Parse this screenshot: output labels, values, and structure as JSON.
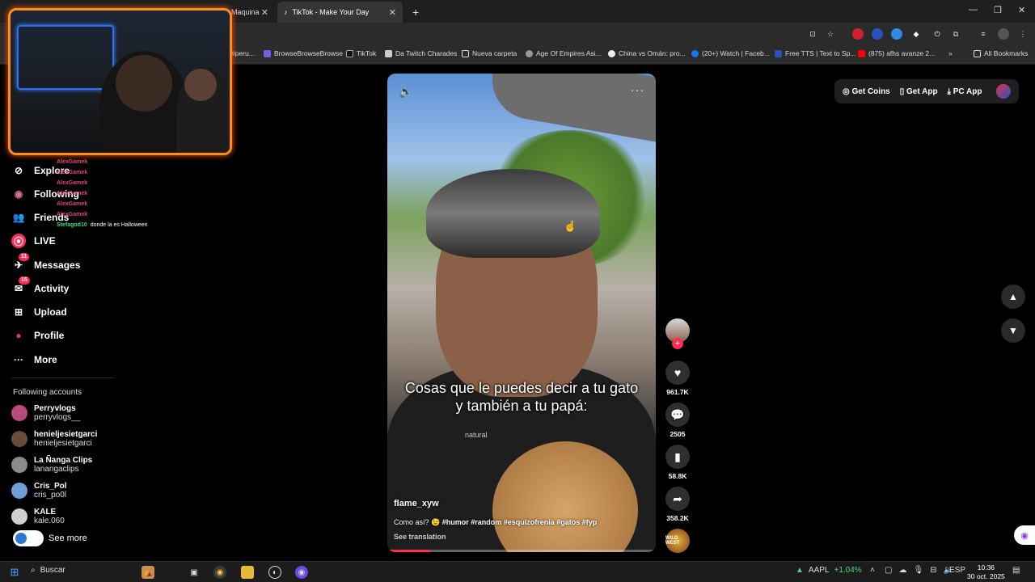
{
  "browser": {
    "tabs": [
      {
        "label": "Maquina",
        "active": false
      },
      {
        "label": "TikTok - Make Your Day",
        "active": true
      }
    ],
    "new_tab": "+",
    "window_controls": [
      "—",
      "❐",
      "✕"
    ],
    "bookmarks": [
      {
        "label": "#peru..."
      },
      {
        "label": "BrowseBrowseBrowse"
      },
      {
        "label": "TikTok"
      },
      {
        "label": "Da Twitch Charades"
      },
      {
        "label": "Nueva carpeta"
      },
      {
        "label": "Age Of Empires Asi..."
      },
      {
        "label": "China vs Omán: pro..."
      },
      {
        "label": "(20+) Watch | Faceb..."
      },
      {
        "label": "Free TTS | Text to Sp..."
      },
      {
        "label": "(875) afhs avanze 2..."
      }
    ],
    "bookmarks_overflow": "»",
    "all_bookmarks": "All Bookmarks"
  },
  "stream_overlay": {
    "chat": [
      {
        "user": "AlexGamek",
        "msg": "",
        "color": "#e0467a"
      },
      {
        "user": "AlexGamek",
        "msg": "",
        "color": "#e0467a"
      },
      {
        "user": "AlexGamek",
        "msg": "",
        "color": "#e0467a"
      },
      {
        "user": "AlexGamek",
        "msg": "",
        "color": "#e0467a"
      },
      {
        "user": "AlexGamek",
        "msg": "",
        "color": "#e0467a"
      },
      {
        "user": "AlexGamek",
        "msg": "",
        "color": "#e0467a"
      },
      {
        "user": "Stefagod10",
        "msg": "donde la es Halloween",
        "color": "#4bd47d"
      }
    ]
  },
  "sidebar": {
    "items": [
      {
        "label": "Explore",
        "icon": "compass-icon",
        "glyph": "⊘"
      },
      {
        "label": "Following",
        "icon": "following-avatar-icon",
        "glyph": "◉"
      },
      {
        "label": "Friends",
        "icon": "friends-icon",
        "glyph": "👥"
      },
      {
        "label": "LIVE",
        "icon": "live-icon",
        "glyph": "⦿"
      },
      {
        "label": "Messages",
        "icon": "messages-icon",
        "glyph": "✈",
        "badge": "11"
      },
      {
        "label": "Activity",
        "icon": "activity-icon",
        "glyph": "✉",
        "badge": "15"
      },
      {
        "label": "Upload",
        "icon": "upload-icon",
        "glyph": "⊞"
      },
      {
        "label": "Profile",
        "icon": "profile-avatar-icon",
        "glyph": "●"
      },
      {
        "label": "More",
        "icon": "more-icon",
        "glyph": "···"
      }
    ],
    "following_title": "Following accounts",
    "accounts": [
      {
        "name": "Perryvlogs",
        "handle": "perryvlogs__",
        "color": "#b84a7a"
      },
      {
        "name": "henieljesietgarci",
        "handle": "henieljesietgarci",
        "color": "#6a4a3a"
      },
      {
        "name": "La Ñanga Clips",
        "handle": "lanangaclips",
        "color": "#8a8a8a"
      },
      {
        "name": "Cris_Pol",
        "handle": "cris_po0l",
        "color": "#6ba0d8"
      },
      {
        "name": "KALE",
        "handle": "kale.060",
        "color": "#d0d0d0"
      }
    ],
    "see_more": "See more"
  },
  "video": {
    "caption": "Cosas que le puedes decir a tu gato y también a tu papá:",
    "author": "flame_xyw",
    "description": "Como así? 😉",
    "hashtags": "#humor #random #esquizofrenia #gatos #fyp",
    "see_translation": "See translation",
    "progress": 0.16,
    "shirt_text": "natural"
  },
  "actions": {
    "likes": "961.7K",
    "comments": "2505",
    "saves": "58.8K",
    "shares": "358.2K",
    "sound_label": "WILD WEST"
  },
  "topbar": {
    "get_coins": "Get Coins",
    "get_app": "Get App",
    "pc_app": "PC App"
  },
  "taskbar": {
    "search": "Buscar",
    "stock_symbol": "AAPL",
    "stock_change": "+1.04%",
    "language": "ESP",
    "time": "10:36",
    "date": "30 oct. 2025"
  }
}
